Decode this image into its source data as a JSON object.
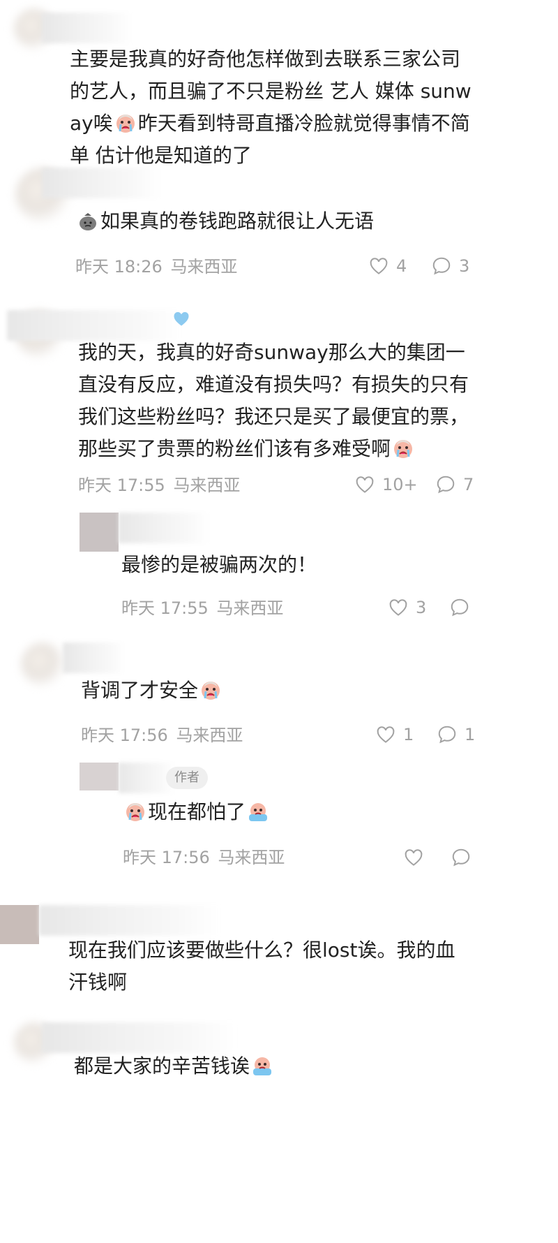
{
  "comments": [
    {
      "text_a": "主要是我真的好奇他怎样做到去联系三家公司的艺人，而且骗了不只是粉丝 艺人 媒体 sunway唉",
      "text_b": "昨天看到特哥直播冷脸就觉得事情不简单 估计他是知道的了"
    },
    {
      "text": "如果真的卷钱跑路就很让人无语",
      "time": "昨天 18:26",
      "location": "马来西亚",
      "likes": "4",
      "replies": "3"
    },
    {
      "text": "我的天，我真的好奇sunway那么大的集团一直没有反应，难道没有损失吗？有损失的只有我们这些粉丝吗？我还只是买了最便宜的票，那些买了贵票的粉丝们该有多难受啊",
      "time": "昨天 17:55",
      "location": "马来西亚",
      "likes": "10+",
      "replies": "7"
    },
    {
      "text": "最惨的是被骗两次的！",
      "time": "昨天 17:55",
      "location": "马来西亚",
      "likes": "3",
      "replies": ""
    },
    {
      "text": "背调了才安全",
      "time": "昨天 17:56",
      "location": "马来西亚",
      "likes": "1",
      "replies": "1"
    },
    {
      "badge": "作者",
      "text": "现在都怕了",
      "time": "昨天 17:56",
      "location": "马来西亚",
      "likes": "",
      "replies": ""
    },
    {
      "text": "现在我们应该要做些什么？很lost诶。我的血汗钱啊"
    },
    {
      "text": "都是大家的辛苦钱诶"
    }
  ],
  "icons": {
    "like": "heart-outline-icon",
    "reply": "comment-bubble-icon",
    "emoji_cry": "crying-face-emoji",
    "emoji_bag": "money-bag-emoji"
  },
  "colors": {
    "text": "#222222",
    "meta": "#a2a2a2",
    "badge_bg": "#efefef"
  }
}
